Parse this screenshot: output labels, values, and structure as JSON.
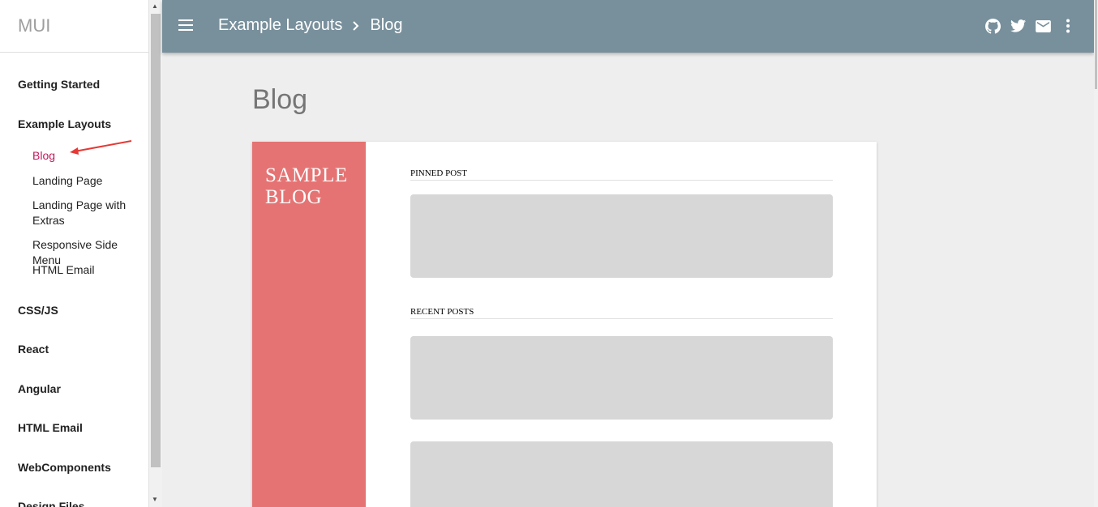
{
  "sidebar": {
    "brand": "MUI",
    "items": [
      {
        "label": "Getting Started"
      },
      {
        "label": "Example Layouts"
      },
      {
        "label": "Blog"
      },
      {
        "label": "Landing Page"
      },
      {
        "label": "Landing Page with Extras"
      },
      {
        "label": "Responsive Side Menu"
      },
      {
        "label": "HTML Email"
      },
      {
        "label": "CSS/JS"
      },
      {
        "label": "React"
      },
      {
        "label": "Angular"
      },
      {
        "label": "HTML Email"
      },
      {
        "label": "WebComponents"
      },
      {
        "label": "Design Files"
      }
    ]
  },
  "appbar": {
    "breadcrumb": [
      "Example Layouts",
      "Blog"
    ],
    "icons": [
      "github-icon",
      "twitter-icon",
      "email-icon",
      "more-vert-icon"
    ]
  },
  "main": {
    "title": "Blog",
    "blog": {
      "side_title": "SAMPLE BLOG",
      "pinned_label": "PINNED POST",
      "recent_label": "RECENT POSTS"
    }
  },
  "colors": {
    "appbar": "#78909c",
    "blog_side": "#e57373",
    "active_link": "#c2185b",
    "placeholder": "#d7d7d7"
  }
}
